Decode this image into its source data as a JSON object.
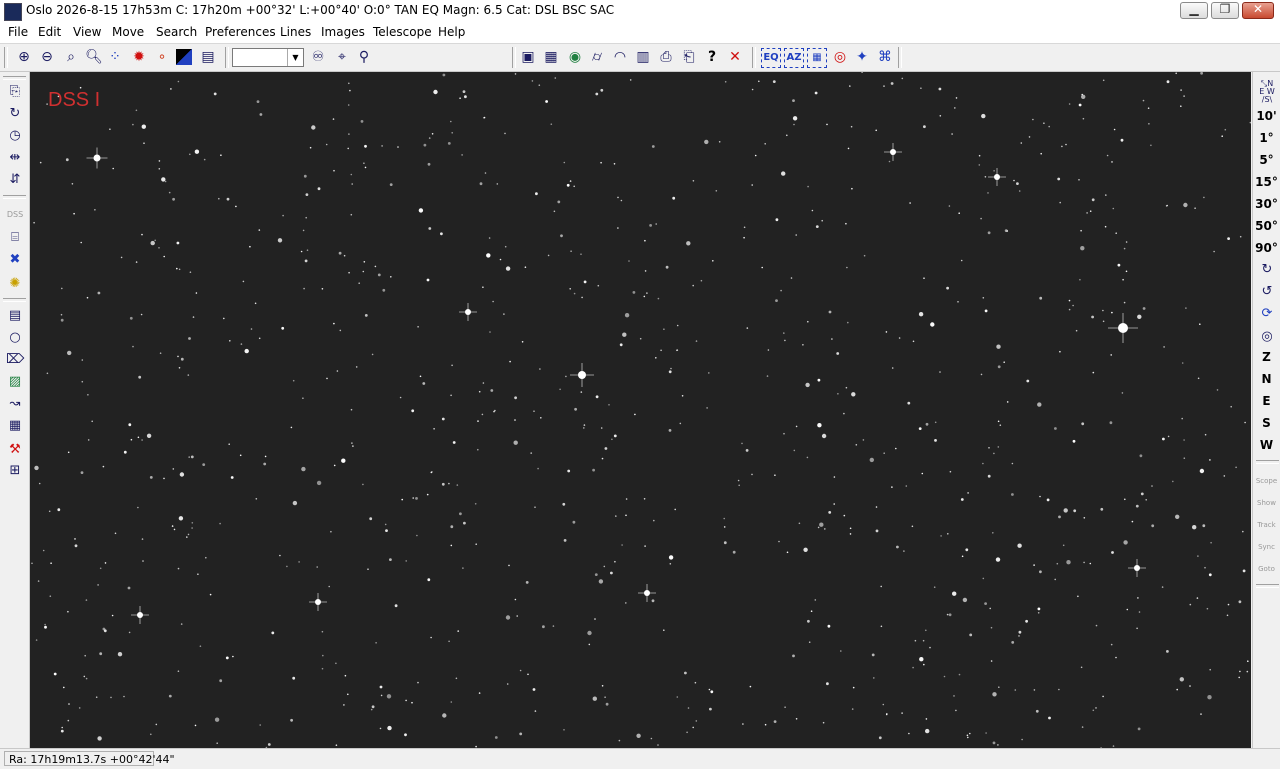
{
  "window": {
    "title": "Oslo 2026-8-15  17h53m C: 17h20m +00°32' L:+00°40' O:0° TAN EQ Magn: 6.5 Cat: DSL BSC SAC",
    "min_glyph": "▁",
    "max_glyph": "❐",
    "close_glyph": "✕"
  },
  "menu": [
    "File",
    "Edit",
    "View",
    "Move",
    "Search",
    "Preferences",
    "Lines",
    "Images",
    "Telescope",
    "Help"
  ],
  "toolbar": {
    "combo_value": "",
    "help_glyph": "?",
    "close_glyph": "✕"
  },
  "right_toolbar": {
    "fov_labels": [
      "10'",
      "1°",
      "5°",
      "15°",
      "30°",
      "50°",
      "90°"
    ],
    "direction_labels": [
      "Z",
      "N",
      "E",
      "S",
      "W"
    ],
    "telescope_labels": [
      "Scope",
      "Show",
      "Track",
      "Sync",
      "Goto"
    ]
  },
  "sky": {
    "survey_label": "DSS I"
  },
  "status": {
    "ra_dec": "Ra: 17h19m13.7s +00°42'44\""
  },
  "colors": {
    "sky_background": "#222222",
    "survey_label": "#d03030",
    "close_red": "#d01010"
  }
}
